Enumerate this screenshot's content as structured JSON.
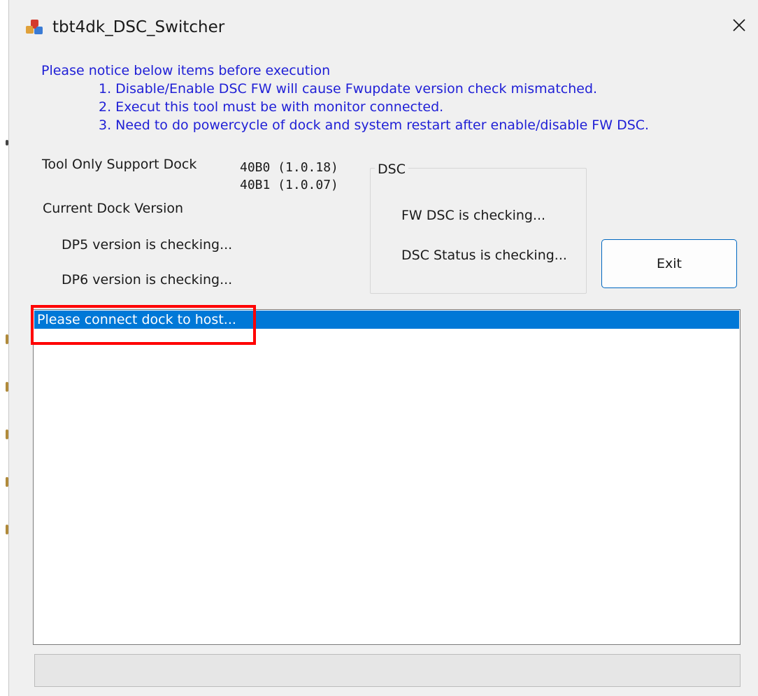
{
  "window": {
    "title": "tbt4dk_DSC_Switcher",
    "close_glyph": "✕",
    "icon": "app-puzzle-icon"
  },
  "notice": {
    "heading": "Please notice below items before execution",
    "items": [
      "1. Disable/Enable DSC FW will cause Fwupdate version check mismatched.",
      "2. Execut this tool must be with monitor connected.",
      "3. Need to do powercycle of dock and system restart after enable/disable FW DSC."
    ],
    "color": "#1f1fd6"
  },
  "dock": {
    "support_label": "Tool Only Support Dock",
    "support_versions": [
      "40B0 (1.0.18)",
      "40B1 (1.0.07)"
    ],
    "current_label": "Current Dock Version",
    "dp5_status": "DP5 version is checking...",
    "dp6_status": "DP6 version is checking..."
  },
  "dsc": {
    "group_label": "DSC",
    "fw_status": "FW DSC is checking...",
    "dsc_status": "DSC Status is checking..."
  },
  "buttons": {
    "exit_label": "Exit"
  },
  "log": {
    "items": [
      "Please connect dock to host..."
    ],
    "selected_index": 0,
    "selection_color": "#0078d7"
  },
  "annotation": {
    "color": "#ff0000"
  }
}
